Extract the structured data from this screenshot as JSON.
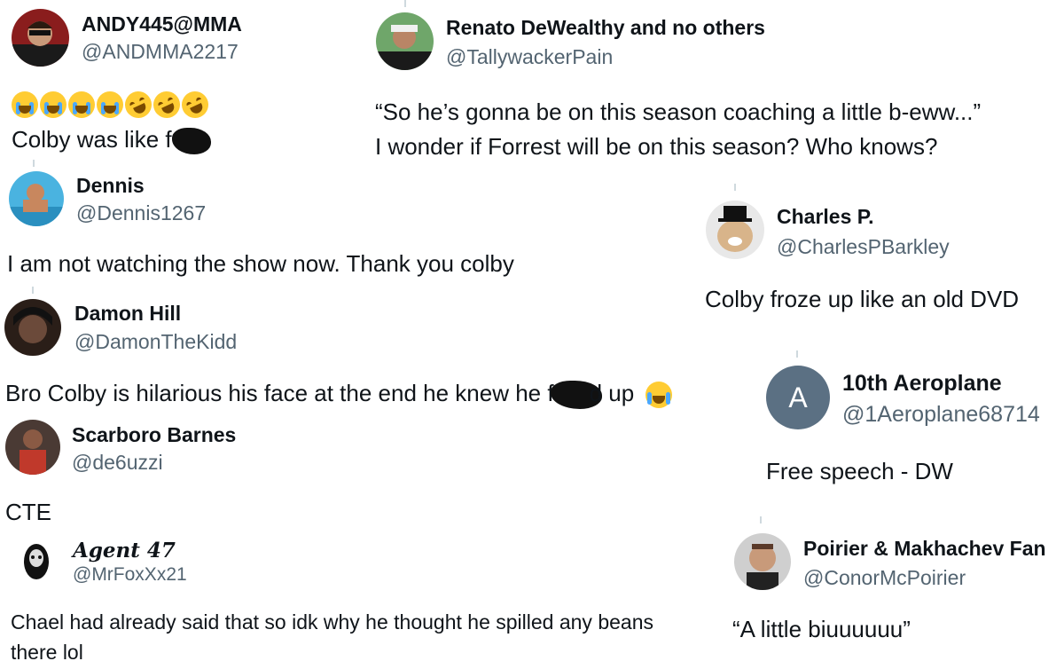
{
  "tweets": [
    {
      "name": "ANDY445@MMA",
      "handle": "@ANDMMA2217",
      "text_prefix": "Colby was like f",
      "emoji_line": "😭😭😭😭🤣🤣🤣"
    },
    {
      "name": "Renato DeWealthy and no others",
      "handle": "@TallywackerPain",
      "line1": "“So he’s gonna be on this season coaching a little b-eww...”",
      "line2": "I wonder if Forrest will be on this season? Who knows?"
    },
    {
      "name": "Dennis",
      "handle": "@Dennis1267",
      "text": "I am not watching the show now. Thank you colby"
    },
    {
      "name": "Charles P.",
      "handle": "@CharlesPBarkley",
      "text": "Colby froze up like an old DVD"
    },
    {
      "name": "Damon Hill",
      "handle": "@DamonTheKidd",
      "text_prefix": "Bro Colby is hilarious his face at the end he knew he f",
      "text_suffix": "d up"
    },
    {
      "name": "10th Aeroplane",
      "handle": "@1Aeroplane68714",
      "avatar_letter": "A",
      "text": "Free speech - DW"
    },
    {
      "name": "Scarboro Barnes",
      "handle": "@de6uzzi",
      "text": "CTE"
    },
    {
      "name": "Agent 47",
      "handle": "@MrFoxXx21",
      "line1": "Chael had already said that so idk why he thought he spilled any beans",
      "line2": "there lol"
    },
    {
      "name": "Poirier & Makhachev Fan",
      "handle": "@ConorMcPoirier",
      "text": "“A little biuuuuuu”"
    }
  ],
  "colors": {
    "text": "#0f1419",
    "handle": "#536471",
    "thread": "#cfd9de",
    "emoji": "#ffcc33"
  }
}
